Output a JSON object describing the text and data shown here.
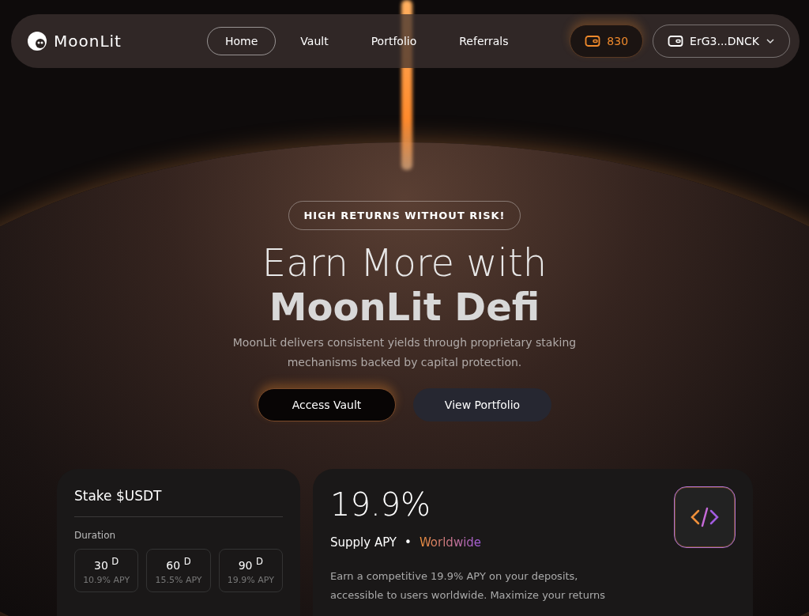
{
  "brand": {
    "name": "MoonLit"
  },
  "nav": [
    {
      "label": "Home",
      "selected": true
    },
    {
      "label": "Vault",
      "selected": false
    },
    {
      "label": "Portfolio",
      "selected": false
    },
    {
      "label": "Referrals",
      "selected": false
    }
  ],
  "points": "830",
  "wallet": "ErG3...DNCK",
  "hero": {
    "badge": "HIGH RETURNS WITHOUT RISK!",
    "title_line_1": "Earn More with",
    "title_line_2": "MoonLit Defi",
    "subtitle": "MoonLit delivers consistent yields through proprietary staking mechanisms backed by capital protection.",
    "buttons": [
      {
        "label": "Access Vault",
        "kind": "primary"
      },
      {
        "label": "View Portfolio",
        "kind": "secondary"
      }
    ]
  },
  "stake_card": {
    "title": "Stake $USDT",
    "duration_label": "Duration",
    "durations": [
      {
        "days": "30 $^{D}$",
        "apy": "10.9% APY"
      },
      {
        "days": "60 $^{D}$",
        "apy": "15.5% APY"
      },
      {
        "days": "90 $^{D}$",
        "apy": "19.9% APY"
      }
    ]
  },
  "apy_card": {
    "value": "19.9%",
    "label": "Supply APY",
    "separator": "•",
    "region": "Worldwide",
    "description": "Earn a competitive 19.9% APY on your deposits, accessible to users worldwide. Maximize your returns"
  }
}
